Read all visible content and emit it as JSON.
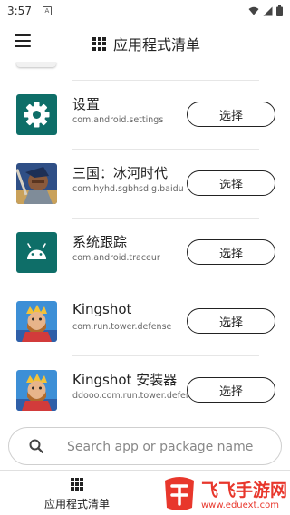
{
  "status_bar": {
    "time": "3:57",
    "notification_badge": "A"
  },
  "app_bar": {
    "title": "应用程式清单"
  },
  "apps": [
    {
      "name": "设置",
      "package": "com.android.settings",
      "button_label": "选择",
      "icon": "settings-gear-icon",
      "icon_color": "#0e6e68"
    },
    {
      "name": "三国：冰河时代",
      "package": "com.hyhd.sgbhsd.g.baidu",
      "button_label": "选择",
      "icon": "warrior-icon"
    },
    {
      "name": "系统跟踪",
      "package": "com.android.traceur",
      "button_label": "选择",
      "icon": "android-icon",
      "icon_color": "#0e6e68"
    },
    {
      "name": "Kingshot",
      "package": "com.run.tower.defense",
      "button_label": "选择",
      "icon": "king-icon"
    },
    {
      "name": "Kingshot 安装器",
      "package": "ddooo.com.run.tower.defense",
      "button_label": "选择",
      "icon": "king-icon"
    }
  ],
  "search": {
    "placeholder": "Search app or package name",
    "value": ""
  },
  "bottom_nav": {
    "item_label": "应用程式清单"
  },
  "watermark": {
    "text": "飞飞手游网",
    "url": "www.eduext.com"
  }
}
